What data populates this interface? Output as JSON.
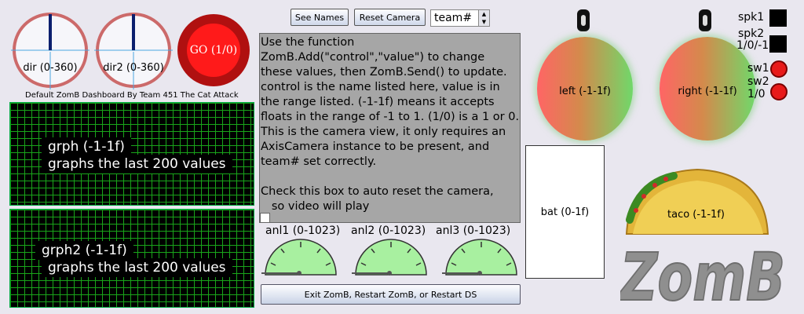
{
  "dials": [
    {
      "label": "dir (0-360)"
    },
    {
      "label": "dir2 (0-360)"
    }
  ],
  "go_button": {
    "label": "GO (1/0)"
  },
  "credit": "Default ZomB Dashboard By Team 451 The Cat Attack",
  "graphs": [
    {
      "line1": "grph (-1-1f)",
      "line2": "graphs the last 200 values"
    },
    {
      "line1": "grph2 (-1-1f)",
      "line2": "graphs the last 200 values"
    }
  ],
  "toolbar": {
    "see_names": "See Names",
    "reset_camera": "Reset Camera",
    "team_value": "team#"
  },
  "info_text": "Use the function ZomB.Add(\"control\",\"value\") to change these values, then ZomB.Send() to update. control is the name listed here, value is in the range listed. (-1-1f) means it accepts floats in the range of -1 to 1. (1/0) is a 1 or 0.\nThis is the camera view, it only requires an AxisCamera instance to be present, and team# set correctly.\n\nCheck this box to auto reset the camera,\n   so video will play",
  "analog_gauges": [
    {
      "label": "anl1 (0-1023)"
    },
    {
      "label": "anl2 (0-1023)"
    },
    {
      "label": "anl3 (0-1023)"
    }
  ],
  "exit_button": "Exit ZomB, Restart ZomB, or Restart DS",
  "motors": [
    {
      "label": "left (-1-1f)"
    },
    {
      "label": "right (-1-1f)"
    }
  ],
  "battery": {
    "label": "bat (0-1f)"
  },
  "side": {
    "spk1": "spk1",
    "spk2_line1": "spk2",
    "spk2_line2": "1/0/-1",
    "sw1": "sw1",
    "sw2": "sw2",
    "sw_range": "1/0"
  },
  "taco": {
    "label": "taco (-1-1f)"
  },
  "logo": "ZomB",
  "colors": {
    "background": "#e9e7ef",
    "graph_grid": "#19a51a",
    "gauge_fill": "#a8f0a0",
    "led_red": "#e81a1a"
  }
}
